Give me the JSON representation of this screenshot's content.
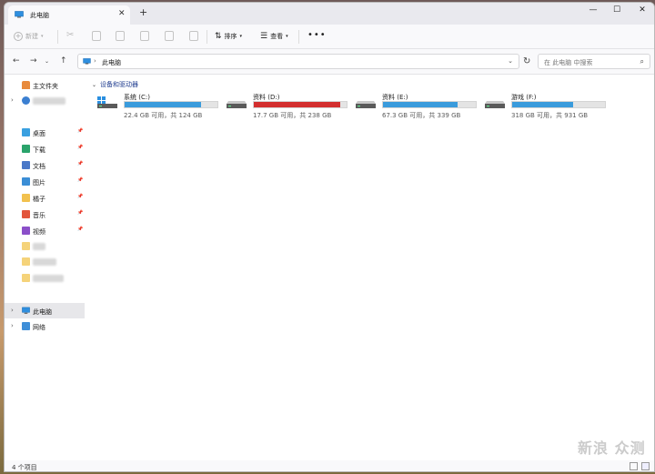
{
  "window": {
    "tab_title": "此电脑",
    "new_tab": "+",
    "close_tab": "✕",
    "controls": {
      "minimize": "—",
      "maximize": "☐",
      "close": "✕"
    }
  },
  "command_bar": {
    "new_label": "新建",
    "sort_label": "排序",
    "view_label": "查看",
    "more_label": "•••"
  },
  "address_bar": {
    "path": "此电脑",
    "search_placeholder": "在 此电脑 中搜索"
  },
  "sidebar": {
    "home": "主文件夹",
    "quick_access": [
      {
        "label": "桌面",
        "icon": "desktop-icon",
        "color": "#3aa0e0"
      },
      {
        "label": "下载",
        "icon": "download-icon",
        "color": "#2aa36b"
      },
      {
        "label": "文档",
        "icon": "document-icon",
        "color": "#4a78c8"
      },
      {
        "label": "图片",
        "icon": "picture-icon",
        "color": "#3b8ed6"
      },
      {
        "label": "橘子",
        "icon": "folder-icon",
        "color": "#f2c14e"
      },
      {
        "label": "音乐",
        "icon": "music-icon",
        "color": "#e2553b"
      },
      {
        "label": "视频",
        "icon": "video-icon",
        "color": "#8b4fc9"
      }
    ],
    "this_pc": "此电脑",
    "network": "网络"
  },
  "main": {
    "group_title": "设备和驱动器",
    "drives": [
      {
        "name": "系统 (C:)",
        "info": "22.4 GB 可用，共 124 GB",
        "used_fraction": 0.82,
        "bar_color": "#3a9bdc"
      },
      {
        "name": "资料 (D:)",
        "info": "17.7 GB 可用，共 238 GB",
        "used_fraction": 0.93,
        "bar_color": "#d32f2f"
      },
      {
        "name": "资料 (E:)",
        "info": "67.3 GB 可用，共 339 GB",
        "used_fraction": 0.8,
        "bar_color": "#3a9bdc"
      },
      {
        "name": "游戏 (F:)",
        "info": "318 GB 可用，共 931 GB",
        "used_fraction": 0.66,
        "bar_color": "#3a9bdc"
      }
    ]
  },
  "status_bar": {
    "count": "4 个项目"
  },
  "watermark": "新浪 众测"
}
